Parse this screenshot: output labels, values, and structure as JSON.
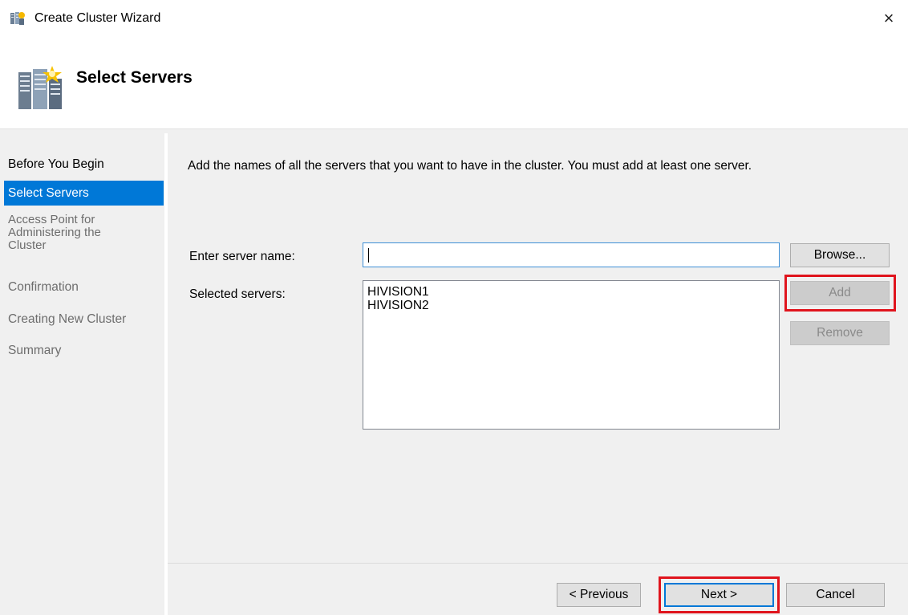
{
  "window": {
    "title": "Create Cluster Wizard",
    "close_glyph": "×"
  },
  "header": {
    "title": "Select Servers"
  },
  "nav": {
    "items": [
      {
        "label": "Before You Begin",
        "state": "done"
      },
      {
        "label": "Select Servers",
        "state": "active"
      },
      {
        "label": "Access Point for Administering the Cluster",
        "state": "pending"
      },
      {
        "label": "Confirmation",
        "state": "pending"
      },
      {
        "label": "Creating New Cluster",
        "state": "pending"
      },
      {
        "label": "Summary",
        "state": "pending"
      }
    ],
    "access_point_lines": [
      "Access Point for",
      "Administering the",
      "Cluster"
    ]
  },
  "main": {
    "instructions": "Add the names of all the servers that you want to have in the cluster. You must add at least one server.",
    "server_name_label": "Enter server name:",
    "server_name_value": "",
    "selected_servers_label": "Selected servers:",
    "selected_servers": [
      "HIVISION1",
      "HIVISION2"
    ],
    "browse_label": "Browse...",
    "add_label": "Add",
    "remove_label": "Remove"
  },
  "footer": {
    "previous_label": "< Previous",
    "next_label": "Next >",
    "cancel_label": "Cancel"
  },
  "colors": {
    "accent": "#0078d7",
    "highlight": "#e0141d",
    "panel": "#f0f0f0"
  },
  "icons": {
    "app": "cluster-server-icon",
    "header": "cluster-server-large-icon",
    "close": "close-icon"
  }
}
